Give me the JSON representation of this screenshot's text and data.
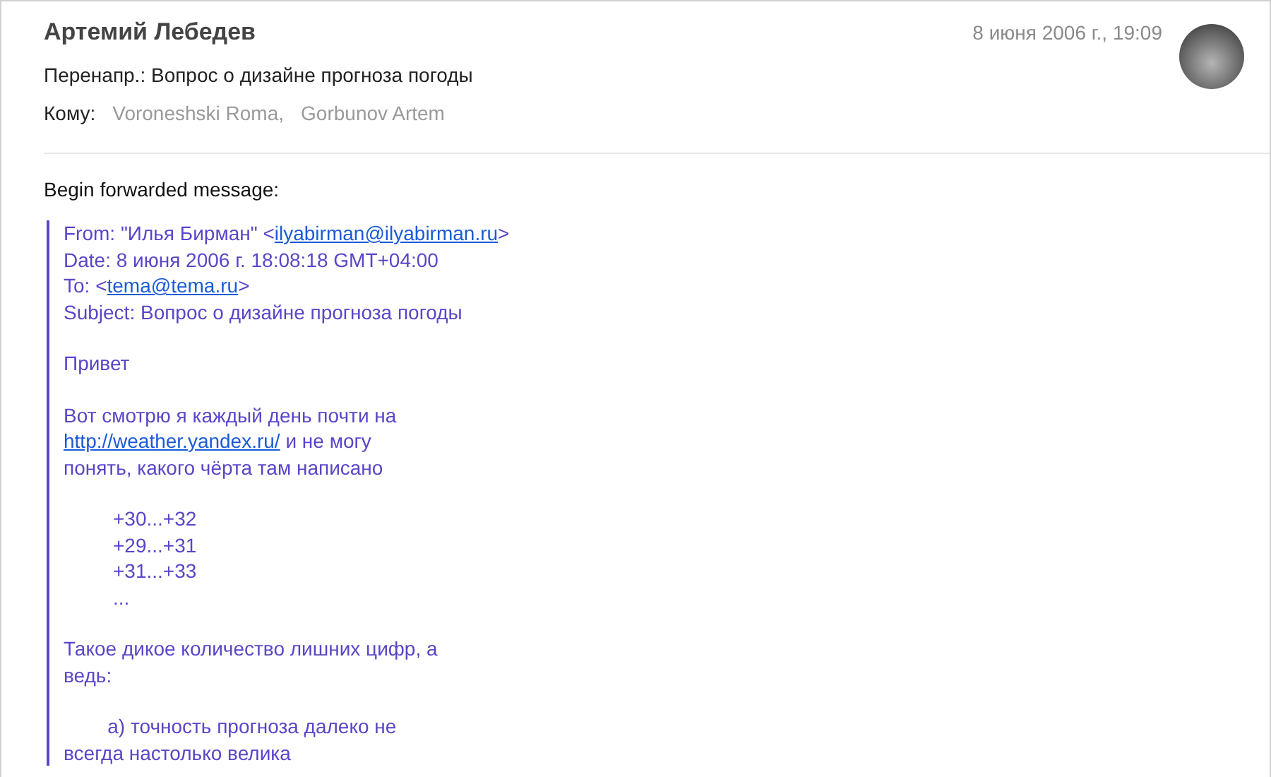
{
  "message": {
    "sender": "Артемий Лебедев",
    "date": "8 июня 2006 г., 19:09",
    "subject": "Перенапр.: Вопрос о дизайне прогноза погоды",
    "to_label": "Кому:",
    "recipients": [
      "Voroneshski Roma,",
      "Gorbunov Artem"
    ]
  },
  "intro": "Begin forwarded message:",
  "quote": [
    {
      "indented": false,
      "lines": [
        [
          {
            "kind": "text",
            "text": "From: \"Илья Бирман\" <"
          },
          {
            "kind": "link",
            "text": "ilyabirman@ilyabirman.ru"
          },
          {
            "kind": "text",
            "text": ">"
          }
        ],
        [
          {
            "kind": "text",
            "text": "Date: 8 июня 2006 г. 18:08:18 GMT+04:00"
          }
        ],
        [
          {
            "kind": "text",
            "text": "To: <"
          },
          {
            "kind": "link",
            "text": "tema@tema.ru"
          },
          {
            "kind": "text",
            "text": ">"
          }
        ],
        [
          {
            "kind": "text",
            "text": "Subject: Вопрос о дизайне прогноза погоды"
          }
        ]
      ]
    },
    {
      "indented": false,
      "lines": [
        [
          {
            "kind": "text",
            "text": "Привет"
          }
        ]
      ]
    },
    {
      "indented": false,
      "lines": [
        [
          {
            "kind": "text",
            "text": "Вот смотрю я каждый день почти на"
          }
        ],
        [
          {
            "kind": "link",
            "text": "http://weather.yandex.ru/"
          },
          {
            "kind": "text",
            "text": " и не могу"
          }
        ],
        [
          {
            "kind": "text",
            "text": "понять, какого чёрта там написано"
          }
        ]
      ]
    },
    {
      "indented": true,
      "lines": [
        [
          {
            "kind": "text",
            "text": "+30...+32"
          }
        ],
        [
          {
            "kind": "text",
            "text": "+29...+31"
          }
        ],
        [
          {
            "kind": "text",
            "text": "+31...+33"
          }
        ],
        [
          {
            "kind": "text",
            "text": "..."
          }
        ]
      ]
    },
    {
      "indented": false,
      "lines": [
        [
          {
            "kind": "text",
            "text": "Такое дикое количество лишних цифр, а"
          }
        ],
        [
          {
            "kind": "text",
            "text": "ведь:"
          }
        ]
      ]
    },
    {
      "indented": false,
      "lines": [
        [
          {
            "kind": "text",
            "text": "        а) точность прогноза далеко не"
          }
        ],
        [
          {
            "kind": "text",
            "text": "всегда настолько велика"
          }
        ]
      ]
    }
  ]
}
